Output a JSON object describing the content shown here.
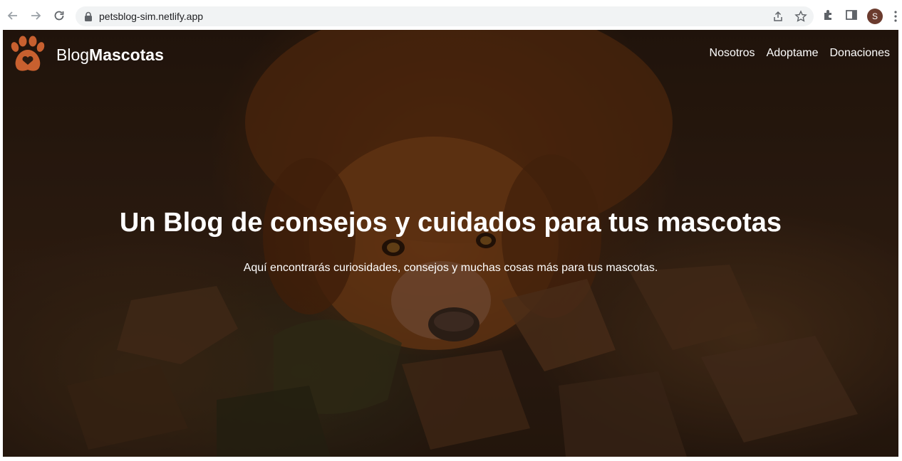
{
  "browser": {
    "url": "petsblog-sim.netlify.app",
    "profile_initial": "S",
    "icons": [
      "back-arrow-icon",
      "forward-arrow-icon",
      "reload-icon",
      "lock-icon",
      "share-icon",
      "bookmark-star-icon",
      "extensions-icon",
      "side-panel-icon",
      "more-vert-icon"
    ]
  },
  "header": {
    "brand_light": "Blog",
    "brand_bold": "Mascotas",
    "nav": [
      {
        "label": "Nosotros"
      },
      {
        "label": "Adoptame"
      },
      {
        "label": "Donaciones"
      }
    ]
  },
  "hero": {
    "title": "Un Blog de consejos y cuidados para tus mascotas",
    "subtitle": "Aquí encontrarás curiosidades, consejos y muchas cosas más para tus mascotas."
  },
  "colors": {
    "logo": "#c8602f",
    "text": "#ffffff",
    "overlay": "#0f0804"
  }
}
